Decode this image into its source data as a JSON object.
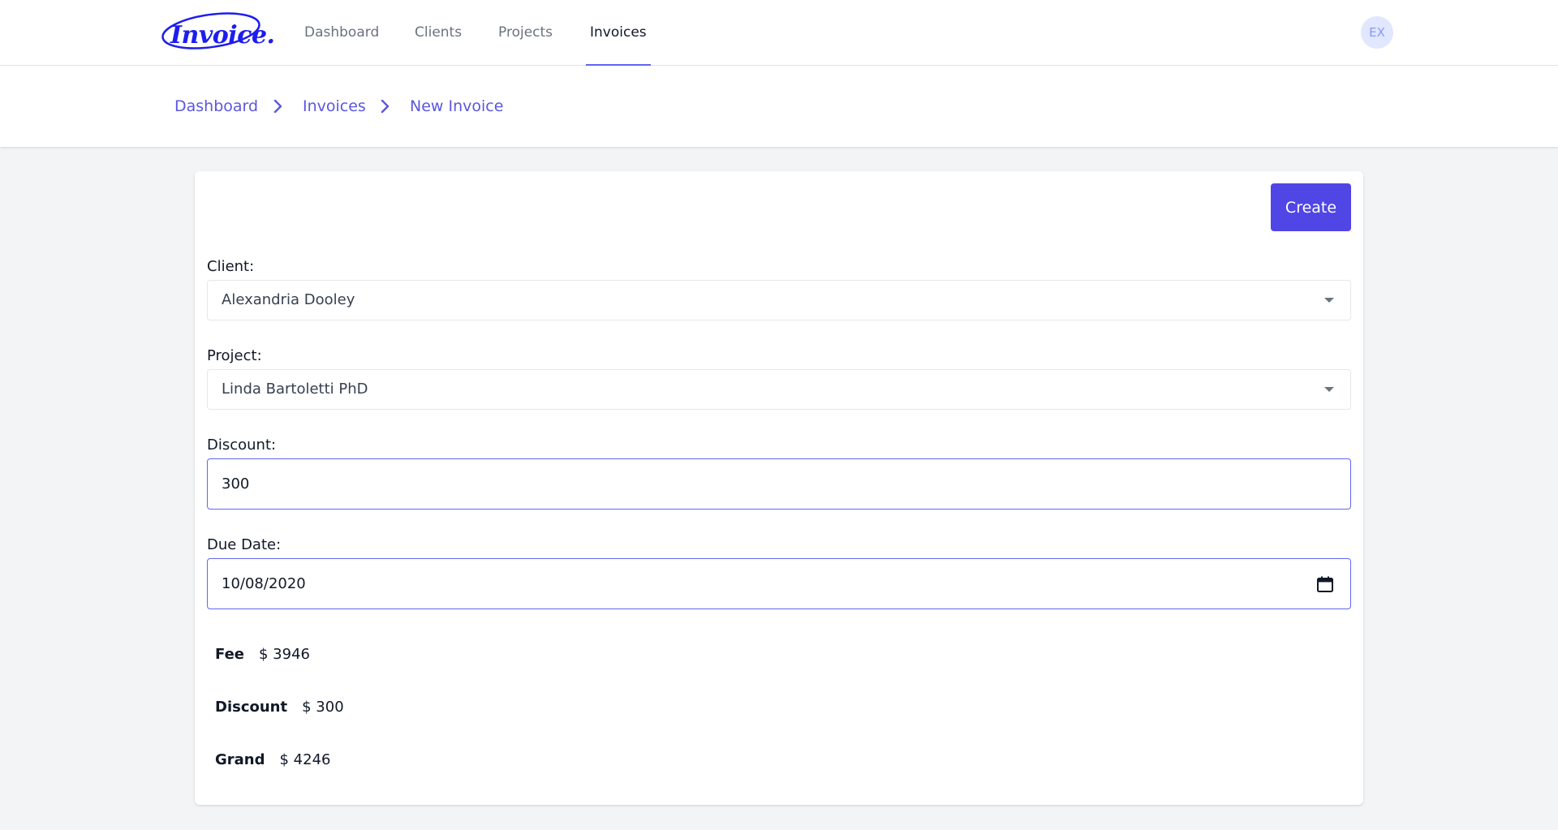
{
  "nav": {
    "logo_text": "Invoice.",
    "links": [
      {
        "label": "Dashboard"
      },
      {
        "label": "Clients"
      },
      {
        "label": "Projects"
      },
      {
        "label": "Invoices",
        "active": true
      }
    ],
    "avatar_initials": "EX"
  },
  "breadcrumb": {
    "items": [
      "Dashboard",
      "Invoices",
      "New Invoice"
    ]
  },
  "form": {
    "create_label": "Create",
    "client": {
      "label": "Client:",
      "value": "Alexandria Dooley"
    },
    "project": {
      "label": "Project:",
      "value": "Linda Bartoletti PhD"
    },
    "discount": {
      "label": "Discount:",
      "value": "300"
    },
    "due_date": {
      "label": "Due Date:",
      "value": "10/08/2020"
    }
  },
  "summary": {
    "fee": {
      "label": "Fee",
      "value": "$ 3946"
    },
    "discount": {
      "label": "Discount",
      "value": "$ 300"
    },
    "grand": {
      "label": "Grand",
      "value": "$ 4246"
    }
  },
  "colors": {
    "accent": "#5046e5",
    "link": "#5b57e0",
    "logo": "#1d1df0",
    "background": "#f3f4f6"
  }
}
